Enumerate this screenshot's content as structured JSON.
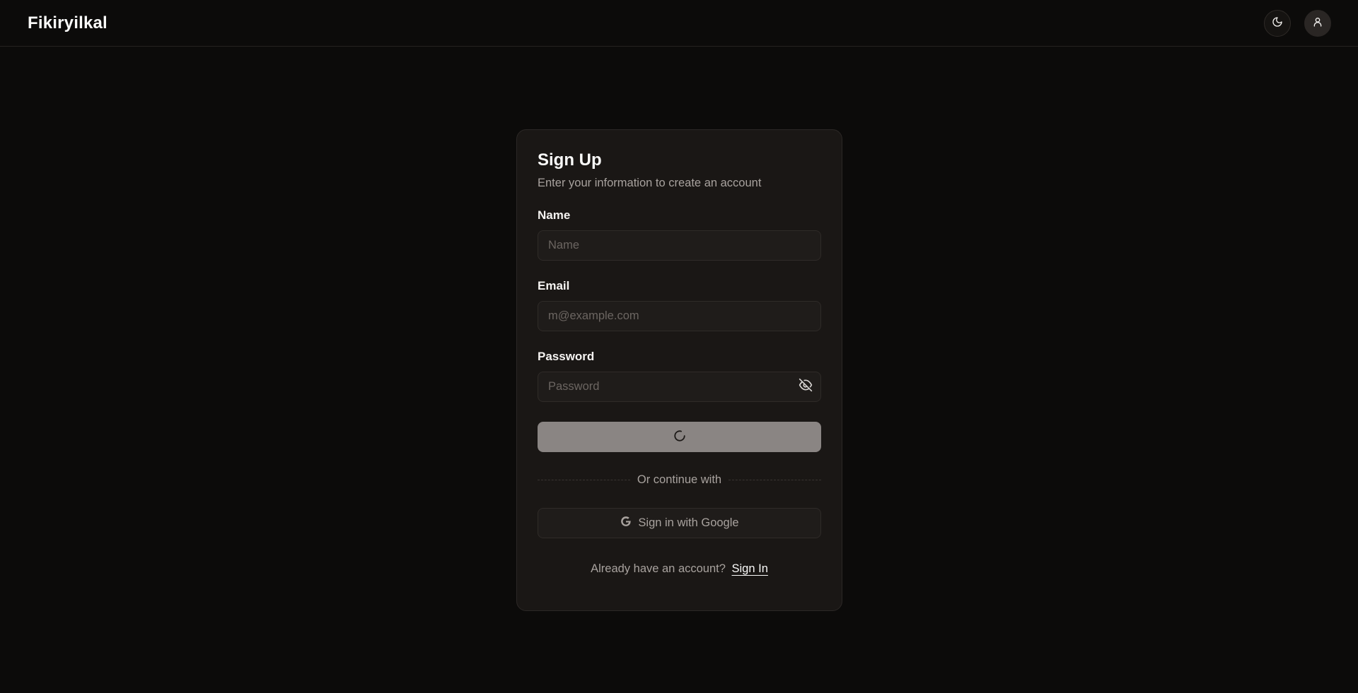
{
  "app": {
    "brand": "Fikiryilkal"
  },
  "header": {
    "theme_toggle_icon": "moon-icon",
    "user_icon": "user-icon"
  },
  "signup": {
    "title": "Sign Up",
    "subtitle": "Enter your information to create an account",
    "name": {
      "label": "Name",
      "placeholder": "Name",
      "value": ""
    },
    "email": {
      "label": "Email",
      "placeholder": "m@example.com",
      "value": ""
    },
    "password": {
      "label": "Password",
      "placeholder": "Password",
      "value": "",
      "toggle_icon": "eye-off-icon"
    },
    "submit": {
      "state": "loading",
      "icon": "spinner-icon"
    },
    "divider_text": "Or continue with",
    "google_button_label": "Sign in with Google",
    "footer_prompt": "Already have an account?",
    "signin_link": "Sign In"
  },
  "colors": {
    "background": "#0c0b0a",
    "card": "#1a1715",
    "submit_disabled": "#8a8583",
    "text_muted": "#a8a29e"
  }
}
